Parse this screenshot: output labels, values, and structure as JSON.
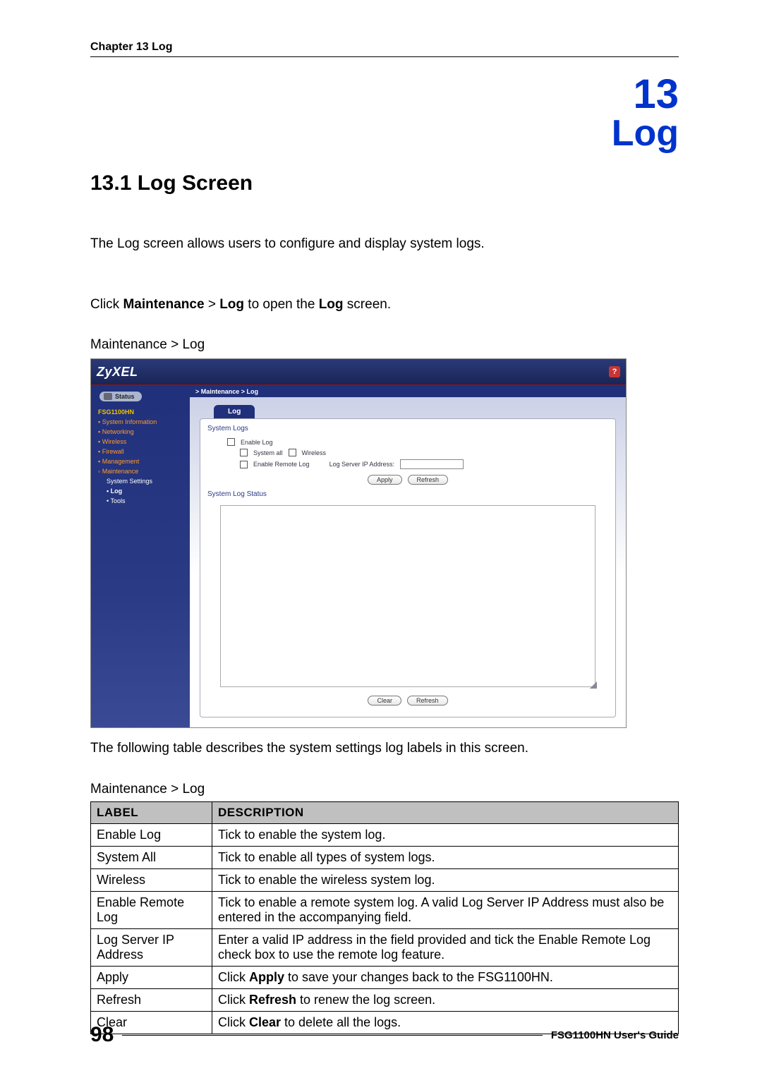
{
  "header": {
    "text": "Chapter 13 Log"
  },
  "chapter": {
    "number": "13",
    "title": "Log"
  },
  "section": {
    "title": "13.1  Log Screen"
  },
  "para": {
    "intro": "The Log screen allows users to configure and display system logs.",
    "click_1": "Click ",
    "click_bold1": "Maintenance",
    "click_gt": " > ",
    "click_bold2": "Log",
    "click_2": " to open the ",
    "click_bold3": "Log",
    "click_3": " screen.",
    "caption1": "Maintenance > Log",
    "following": "The following table describes the system settings log labels in this screen.",
    "table_caption": "Maintenance > Log"
  },
  "shot": {
    "logo": "ZyXEL",
    "help": "?",
    "status": "Status",
    "model": "FSG1100HN",
    "nav": {
      "sysinfo": "System Information",
      "networking": "Networking",
      "wireless": "Wireless",
      "firewall": "Firewall",
      "management": "Management",
      "maintenance": "Maintenance",
      "syssettings": "System Settings",
      "log": "Log",
      "tools": "Tools"
    },
    "breadcrumb": "> Maintenance > Log",
    "tab": "Log",
    "panel": {
      "h1": "System Logs",
      "enable_log": "Enable Log",
      "system_all": "System all",
      "wireless": "Wireless",
      "enable_remote": "Enable Remote Log",
      "server_ip": "Log Server IP Address:",
      "apply": "Apply",
      "refresh": "Refresh",
      "h2": "System Log Status",
      "clear": "Clear",
      "refresh2": "Refresh"
    }
  },
  "table": {
    "head_label": "LABEL",
    "head_desc": "DESCRIPTION",
    "rows": [
      {
        "label": "Enable Log",
        "desc": "Tick to enable the system log."
      },
      {
        "label": "System All",
        "desc": "Tick to enable all types of system logs."
      },
      {
        "label": "Wireless",
        "desc": "Tick to enable the wireless system log."
      },
      {
        "label": "Enable Remote Log",
        "desc": "Tick to enable a remote system log. A valid Log Server IP Address must also be entered in the accompanying field."
      },
      {
        "label": "Log Server IP Address",
        "desc": "Enter a valid IP address in the field provided and tick the Enable Remote Log check box to use the remote log feature."
      },
      {
        "label": "Apply",
        "desc_pre": "Click ",
        "desc_bold": "Apply",
        "desc_post": " to save your changes back to the FSG1100HN."
      },
      {
        "label": "Refresh",
        "desc_pre": "Click ",
        "desc_bold": "Refresh",
        "desc_post": " to renew the log screen."
      },
      {
        "label": "Clear",
        "desc_pre": "Click ",
        "desc_bold": "Clear",
        "desc_post": " to delete all the logs."
      }
    ]
  },
  "footer": {
    "page": "98",
    "guide": "FSG1100HN User's Guide"
  }
}
